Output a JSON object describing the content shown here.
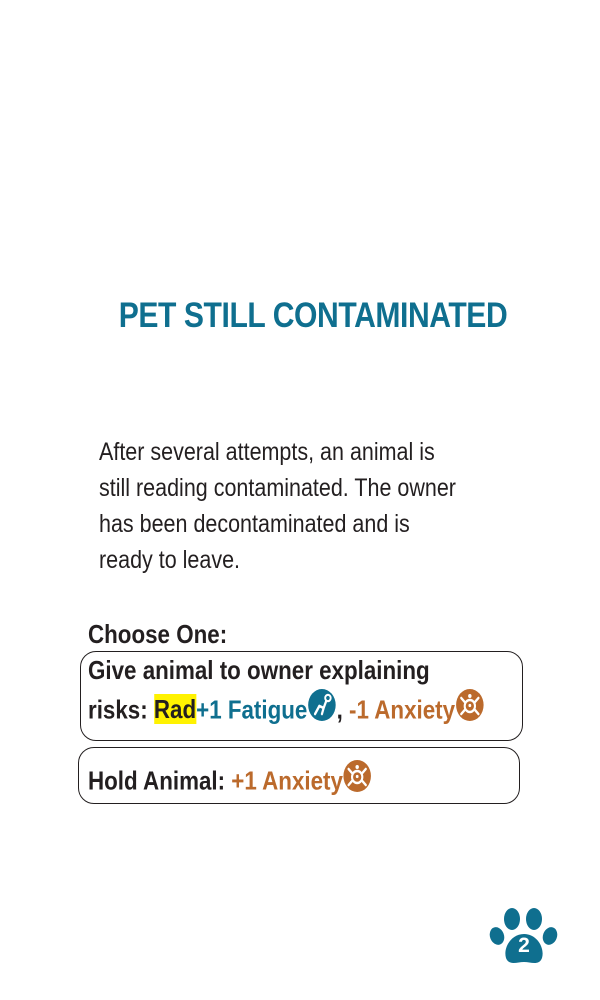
{
  "card": {
    "title": "PET STILL CONTAMINATED",
    "description": "After several attempts, an animal is\nstill reading contaminated. The owner\nhas been decontaminated and is\nready to leave.",
    "choose_label": "Choose One:",
    "option1": {
      "line1": "Give animal to owner explaining",
      "prefix": "risks: ",
      "rad": "Rad",
      "fatigue": "+1 Fatigue",
      "comma": ", ",
      "anxiety": "-1 Anxiety"
    },
    "option2": {
      "prefix": "Hold Animal:  ",
      "anxiety": "+1 Anxiety"
    },
    "card_number": "2"
  },
  "icons": {
    "fatigue": "fatigue-icon",
    "anxiety": "anxiety-icon",
    "paw": "paw-icon"
  },
  "colors": {
    "title": "#0f6f8f",
    "fatigue": "#0f6f8f",
    "anxiety": "#bb6a2c",
    "rad_highlight": "#fff200"
  }
}
